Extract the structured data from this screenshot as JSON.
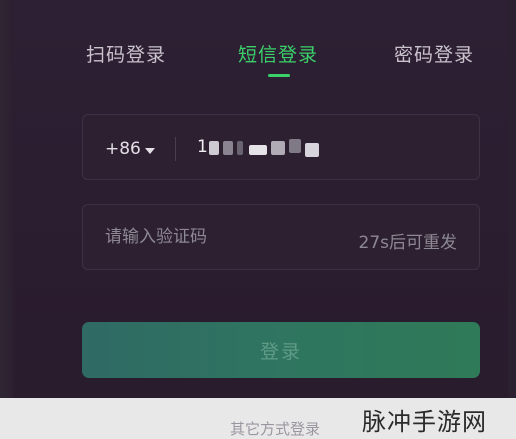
{
  "tabs": [
    {
      "label": "扫码登录",
      "active": false
    },
    {
      "label": "短信登录",
      "active": true
    },
    {
      "label": "密码登录",
      "active": false
    }
  ],
  "phone": {
    "country_code": "+86",
    "value_visible_prefix": "1"
  },
  "code": {
    "placeholder": "请输入验证码",
    "resend_label": "27s后可重发"
  },
  "login_button_label": "登录",
  "other_login_label": "其它方式登录",
  "watermark_text": "脉冲手游网",
  "colors": {
    "accent": "#3ad06a",
    "button": "#2f7560",
    "background": "#2b1e30"
  }
}
